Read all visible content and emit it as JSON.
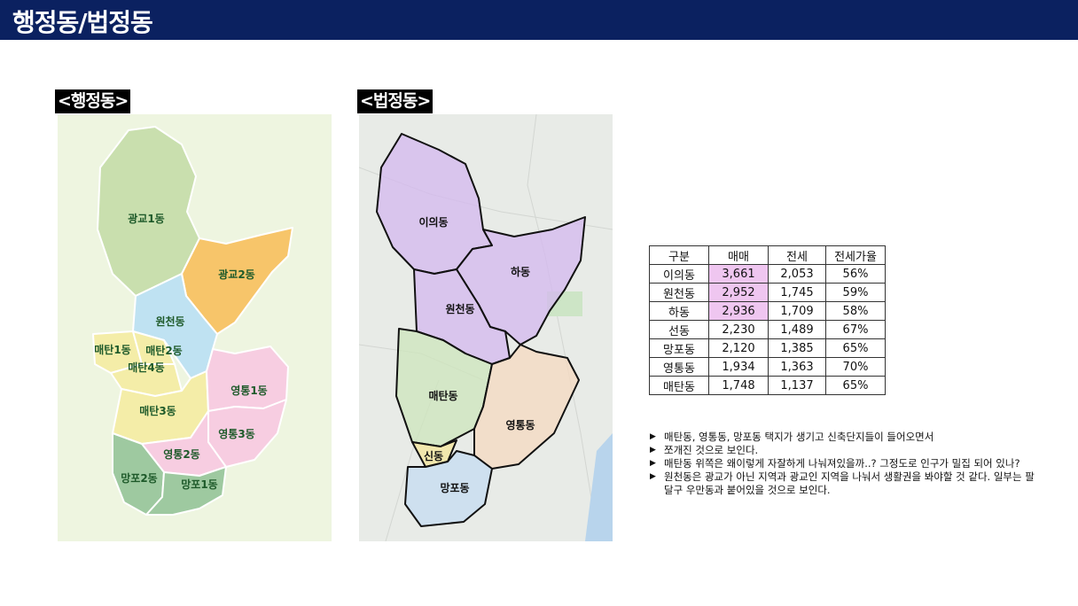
{
  "header": {
    "title": "행정동/법정동"
  },
  "admin_map": {
    "label": "<행정동>",
    "regions": [
      "광교1동",
      "광교2동",
      "원천동",
      "매탄1동",
      "매탄2동",
      "매탄4동",
      "매탄3동",
      "영통1동",
      "영통3동",
      "영통2동",
      "망포2동",
      "망포1동"
    ]
  },
  "legal_map": {
    "label": "<법정동>",
    "regions": [
      "이의동",
      "하동",
      "원천동",
      "매탄동",
      "영통동",
      "신동",
      "망포동"
    ]
  },
  "colors": {
    "header_bg": "#0b2160",
    "highlight": "#efc6f0"
  },
  "price_table": {
    "headers": [
      "구분",
      "매매",
      "전세",
      "전세가율"
    ],
    "rows": [
      [
        "이의동",
        "3,661",
        "2,053",
        "56%"
      ],
      [
        "원천동",
        "2,952",
        "1,745",
        "59%"
      ],
      [
        "하동",
        "2,936",
        "1,709",
        "58%"
      ],
      [
        "선동",
        "2,230",
        "1,489",
        "67%"
      ],
      [
        "망포동",
        "2,120",
        "1,385",
        "65%"
      ],
      [
        "영통동",
        "1,934",
        "1,363",
        "70%"
      ],
      [
        "매탄동",
        "1,748",
        "1,137",
        "65%"
      ]
    ]
  },
  "notes": [
    "매탄동, 영통동, 망포동 택지가 생기고 신축단지들이 들어오면서",
    "쪼개진 것으로 보인다.",
    "매탄동 위쪽은 왜이렇게 자잘하게 나눠져있을까..? 그정도로 인구가 밀집 되어 있나?",
    "원천동은 광교가 아닌 지역과 광교인 지역을 나눠서 생활권을 봐야할 것 같다. 일부는 팔달구 우만동과 붙어있을 것으로 보인다."
  ]
}
